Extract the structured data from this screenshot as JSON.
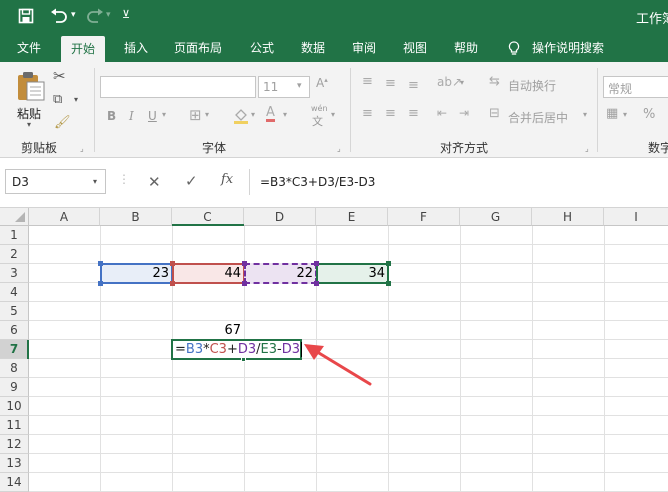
{
  "titlebar": {
    "doc_title": "工作簿"
  },
  "tabs": [
    "文件",
    "开始",
    "插入",
    "页面布局",
    "公式",
    "数据",
    "审阅",
    "视图",
    "帮助"
  ],
  "tell_me": "操作说明搜索",
  "ribbon": {
    "clipboard": {
      "paste": "粘贴",
      "label": "剪贴板"
    },
    "font": {
      "size": "11",
      "label": "字体",
      "wen": "wén"
    },
    "alignment": {
      "wrap": "自动换行",
      "merge": "合并后居中",
      "label": "对齐方式"
    },
    "number": {
      "format": "常规",
      "label": "数字",
      "percent": "%"
    }
  },
  "formula_bar": {
    "name_box": "D3",
    "fx": "fx",
    "formula": "=B3*C3+D3/E3-D3"
  },
  "columns": [
    "A",
    "B",
    "C",
    "D",
    "E",
    "F",
    "G",
    "H",
    "I"
  ],
  "rows": [
    "1",
    "2",
    "3",
    "4",
    "5",
    "6",
    "7",
    "8",
    "9",
    "10",
    "11",
    "12",
    "13",
    "14"
  ],
  "cells": {
    "B3": "23",
    "C3": "44",
    "D3": "22",
    "E3": "34",
    "C6": "67"
  },
  "edit_formula": {
    "eq": "=",
    "b3": "B3",
    "op1": "*",
    "c3": "C3",
    "op2": "+",
    "d3a": "D3",
    "op3": "/",
    "e3": "E3",
    "op4": "-",
    "d3b": "D3"
  },
  "colors": {
    "b3": "#4472c4",
    "c3": "#c0504d",
    "d3": "#7030a0",
    "e3": "#217346",
    "accent": "#217346"
  }
}
